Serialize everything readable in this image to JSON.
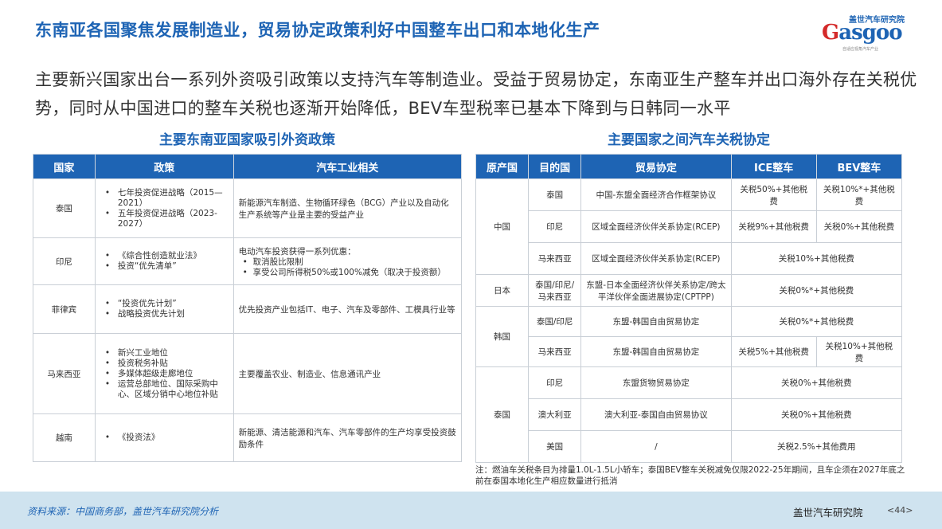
{
  "title": "东南亚各国聚焦发展制造业，贸易协定政策利好中国整车出口和本地化生产",
  "logo": {
    "top": "盖世汽车研究院",
    "main": "Gasgoo",
    "sub": "自适应视角汽车产业"
  },
  "intro": "主要新兴国家出台一系列外资吸引政策以支持汽车等制造业。受益于贸易协定，东南亚生产整车并出口海外存在关税优势，同时从中国进口的整车关税也逐渐开始降低，BEV车型税率已基本下降到与日韩同一水平",
  "left": {
    "heading": "主要东南亚国家吸引外资政策",
    "headers": [
      "国家",
      "政策",
      "汽车工业相关"
    ],
    "rows": [
      {
        "country": "泰国",
        "policies": [
          "七年投资促进战略（2015—2021）",
          "五年投资促进战略（2023-2027）"
        ],
        "auto_intro": "新能源汽车制造、生物循环绿色（BCG）产业以及自动化生产系统等产业是主要的受益产业",
        "auto_items": []
      },
      {
        "country": "印尼",
        "policies": [
          "《综合性创造就业法》",
          "投资“优先清单”"
        ],
        "auto_intro": "电动汽车投资获得一系列优惠：",
        "auto_items": [
          "取消股比限制",
          "享受公司所得税50%或100%减免（取决于投资额）"
        ]
      },
      {
        "country": "菲律宾",
        "policies": [
          "“投资优先计划”",
          "战略投资优先计划"
        ],
        "auto_intro": "优先投资产业包括IT、电子、汽车及零部件、工模具行业等",
        "auto_items": []
      },
      {
        "country": "马来西亚",
        "policies": [
          "新兴工业地位",
          "投资税务补贴",
          "多媒体超级走廊地位",
          "运营总部地位、国际采购中心、区域分销中心地位补贴"
        ],
        "auto_intro": "主要覆盖农业、制造业、信息通讯产业",
        "auto_items": []
      },
      {
        "country": "越南",
        "policies": [
          "《投资法》"
        ],
        "auto_intro": "新能源、清洁能源和汽车、汽车零部件的生产均享受投资鼓励条件",
        "auto_items": []
      }
    ]
  },
  "right": {
    "heading": "主要国家之间汽车关税协定",
    "headers": [
      "原产国",
      "目的国",
      "贸易协定",
      "ICE整车",
      "BEV整车"
    ],
    "origins": [
      "中国",
      "日本",
      "韩国",
      "泰国"
    ],
    "rows": [
      {
        "dest": "泰国",
        "agreement": "中国-东盟全面经济合作框架协议",
        "ice": "关税50%+其他税费",
        "bev": "关税10%*+其他税费"
      },
      {
        "dest": "印尼",
        "agreement": "区域全面经济伙伴关系协定(RCEP)",
        "ice": "关税9%+其他税费",
        "bev": "关税0%+其他税费"
      },
      {
        "dest": "马来西亚",
        "agreement": "区域全面经济伙伴关系协定(RCEP)",
        "merged": "关税10%+其他税费"
      },
      {
        "dest": "泰国/印尼/马来西亚",
        "agreement": "东盟-日本全面经济伙伴关系协定/跨太平洋伙伴全面进展协定(CPTPP)",
        "merged": "关税0%*+其他税费"
      },
      {
        "dest": "泰国/印尼",
        "agreement": "东盟-韩国自由贸易协定",
        "merged": "关税0%*+其他税费"
      },
      {
        "dest": "马来西亚",
        "agreement": "东盟-韩国自由贸易协定",
        "ice": "关税5%+其他税费",
        "bev": "关税10%+其他税费"
      },
      {
        "dest": "印尼",
        "agreement": "东盟货物贸易协定",
        "merged": "关税0%+其他税费"
      },
      {
        "dest": "澳大利亚",
        "agreement": "澳大利亚-泰国自由贸易协议",
        "merged": "关税0%+其他税费"
      },
      {
        "dest": "美国",
        "agreement": "/",
        "merged": "关税2.5%+其他费用"
      }
    ]
  },
  "note": "注：燃油车关税条目为排量1.0L-1.5L小轿车；泰国BEV整车关税减免仅限2022-25年期间，且车企须在2027年底之前在泰国本地化生产相应数量进行抵消",
  "footer": {
    "source": "资料来源：中国商务部，盖世汽车研究院分析",
    "brand": "盖世汽车研究院",
    "page": "<44>"
  }
}
